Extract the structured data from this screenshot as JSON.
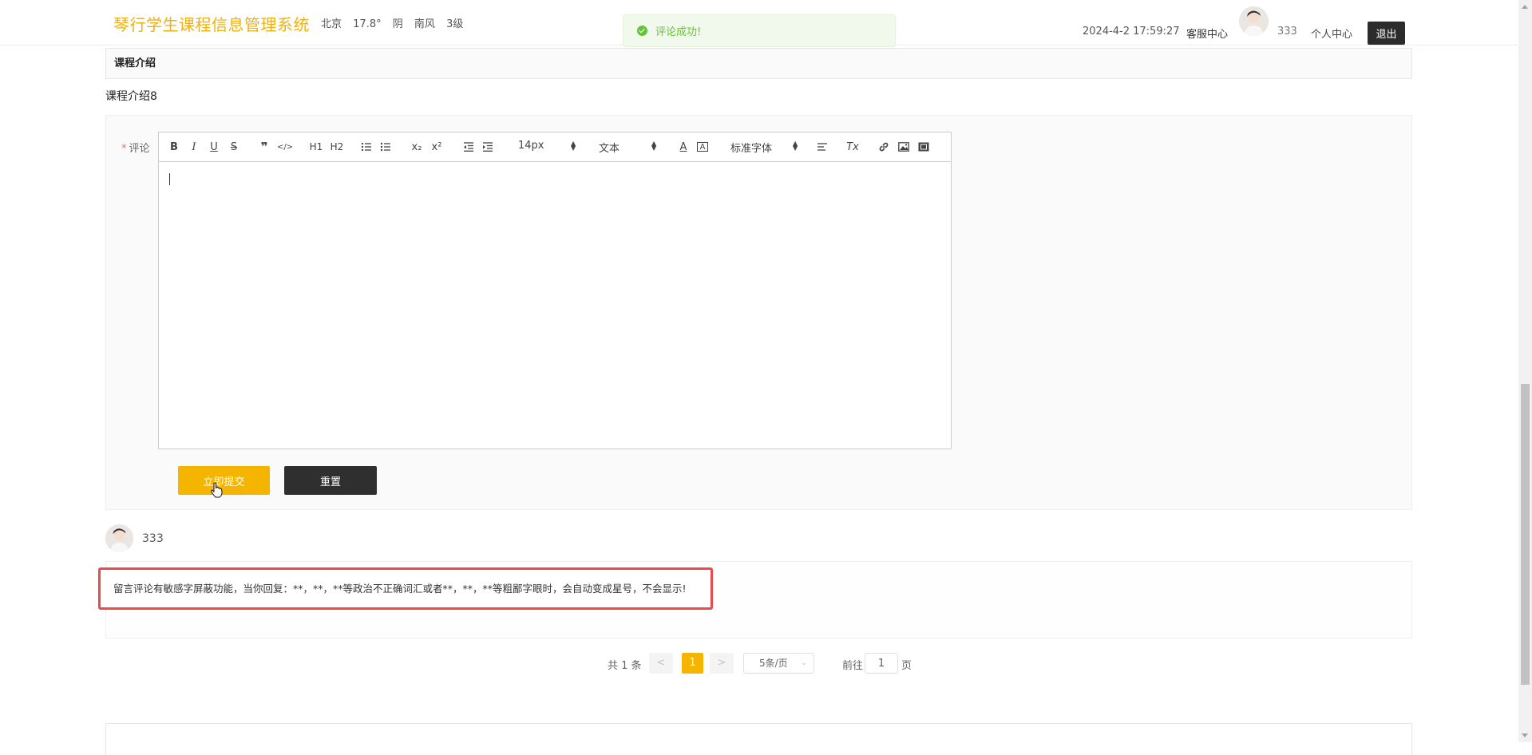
{
  "header": {
    "brand": "琴行学生课程信息管理系统",
    "weather": {
      "city": "北京",
      "temp": "17.8°",
      "condition": "阴",
      "wind": "南风",
      "level": "3级"
    },
    "datetime": "2024-4-2 17:59:27",
    "service_link": "客服中心",
    "username": "333",
    "center_link": "个人中心",
    "logout_label": "退出"
  },
  "toast": {
    "message": "评论成功!",
    "color": "#67c23a"
  },
  "section": {
    "title": "课程介绍",
    "intro_text": "课程介绍8"
  },
  "comment_form": {
    "required_mark": "*",
    "label": "评论",
    "toolbar": {
      "bold": "B",
      "italic": "I",
      "underline": "U",
      "strike": "S",
      "blockquote": "❞",
      "code": "</>",
      "h1": "H1",
      "h2": "H2",
      "ordered_list": "ordered-list-icon",
      "bullet_list": "bullet-list-icon",
      "subscript": "x₂",
      "superscript": "x²",
      "outdent": "outdent-icon",
      "indent": "indent-icon",
      "size_picker": "14px",
      "header_picker": "文本",
      "color": "A",
      "background": "A",
      "font_picker": "标准字体",
      "align": "align-icon",
      "clean": "Tx",
      "link": "link-icon",
      "image": "image-icon",
      "video": "video-icon"
    },
    "editor_value": "",
    "submit_label": "立即提交",
    "reset_label": "重置",
    "accent_color": "#f5b400"
  },
  "comments": [
    {
      "username": "333",
      "content": "留言评论有敏感字屏蔽功能，当你回复：**，**，**等政治不正确词汇或者**，**，**等粗鄙字眼时，会自动变成星号，不会显示!"
    }
  ],
  "pagination": {
    "total_text": "共 1 条",
    "prev": "<",
    "current_page": "1",
    "next": ">",
    "page_size": "5条/页",
    "goto_label": "前往",
    "goto_value": "1",
    "page_suffix": "页"
  }
}
